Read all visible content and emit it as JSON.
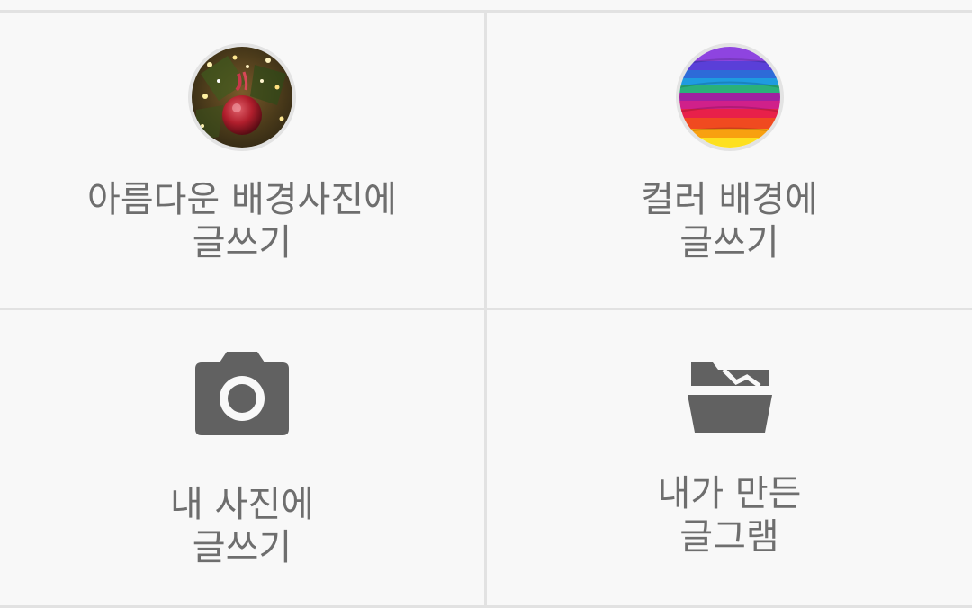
{
  "tiles": [
    {
      "line1": "아름다운 배경사진에",
      "line2": "글쓰기",
      "icon": "christmas-photo-thumbnail"
    },
    {
      "line1": "컬러 배경에",
      "line2": "글쓰기",
      "icon": "rainbow-color-thumbnail"
    },
    {
      "line1": "내 사진에",
      "line2": "글쓰기",
      "icon": "camera-icon"
    },
    {
      "line1": "내가 만든",
      "line2": "글그램",
      "icon": "folder-open-icon"
    }
  ],
  "colors": {
    "background": "#f8f8f8",
    "divider": "#e2e2e2",
    "text": "#6e6e6e",
    "icon": "#616161"
  }
}
